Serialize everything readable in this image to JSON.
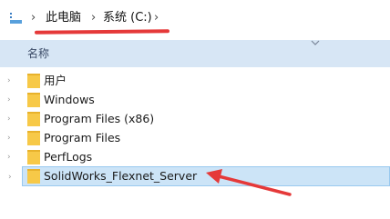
{
  "address_bar": {
    "separator": "›",
    "breadcrumbs": [
      "此电脑",
      "系统 (C:)"
    ]
  },
  "column_header": {
    "name_label": "名称"
  },
  "folders": [
    {
      "name": "用户"
    },
    {
      "name": "Windows"
    },
    {
      "name": "Program Files (x86)"
    },
    {
      "name": "Program Files"
    },
    {
      "name": "PerfLogs"
    },
    {
      "name": "SolidWorks_Flexnet_Server",
      "selected": true
    }
  ],
  "colors": {
    "annotation": "#e53939",
    "header_bg": "#d7e6f5",
    "selection_bg": "#cce4f7",
    "folder": "#f7c948"
  }
}
